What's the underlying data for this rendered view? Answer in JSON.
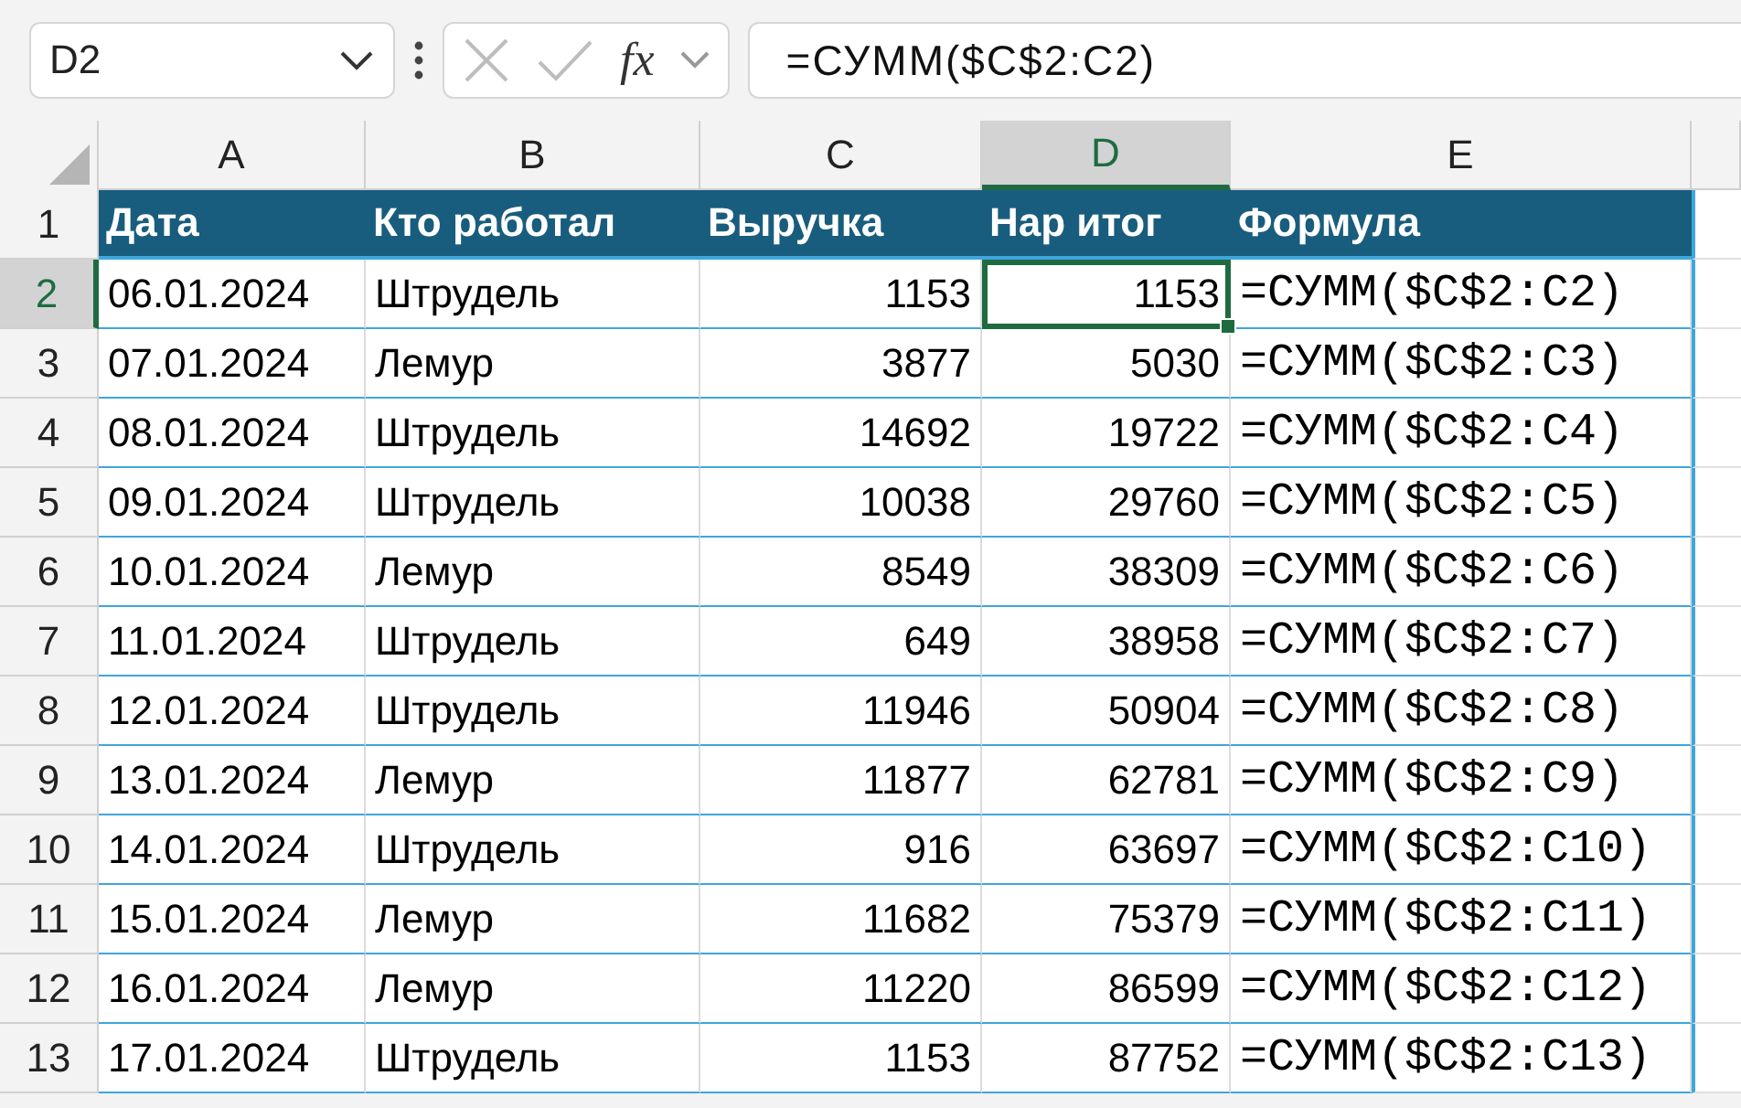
{
  "name_box": {
    "value": "D2"
  },
  "formula_bar": {
    "fx_label": "fx",
    "value": "=СУММ($C$2:C2)"
  },
  "column_headers": [
    {
      "label": "A",
      "selected": false,
      "kind": "text"
    },
    {
      "label": "B",
      "selected": false,
      "kind": "text"
    },
    {
      "label": "C",
      "selected": false,
      "kind": "number"
    },
    {
      "label": "D",
      "selected": true,
      "kind": "number"
    },
    {
      "label": "E",
      "selected": false,
      "kind": "formula"
    }
  ],
  "header_row": {
    "row_number": "1",
    "cells": [
      "Дата",
      "Кто работал",
      "Выручка",
      "Нар итог",
      "Формула"
    ]
  },
  "rows": [
    {
      "row_number": "2",
      "selected": true,
      "cells": [
        {
          "text": "06.01.2024",
          "selected": false
        },
        {
          "text": "Штрудель",
          "selected": false
        },
        {
          "text": "1153",
          "selected": false
        },
        {
          "text": "1153",
          "selected": true
        },
        {
          "text": "=СУММ($C$2:C2)",
          "selected": false
        }
      ]
    },
    {
      "row_number": "3",
      "selected": false,
      "cells": [
        {
          "text": "07.01.2024",
          "selected": false
        },
        {
          "text": "Лемур",
          "selected": false
        },
        {
          "text": "3877",
          "selected": false
        },
        {
          "text": "5030",
          "selected": false
        },
        {
          "text": "=СУММ($C$2:C3)",
          "selected": false
        }
      ]
    },
    {
      "row_number": "4",
      "selected": false,
      "cells": [
        {
          "text": "08.01.2024",
          "selected": false
        },
        {
          "text": "Штрудель",
          "selected": false
        },
        {
          "text": "14692",
          "selected": false
        },
        {
          "text": "19722",
          "selected": false
        },
        {
          "text": "=СУММ($C$2:C4)",
          "selected": false
        }
      ]
    },
    {
      "row_number": "5",
      "selected": false,
      "cells": [
        {
          "text": "09.01.2024",
          "selected": false
        },
        {
          "text": "Штрудель",
          "selected": false
        },
        {
          "text": "10038",
          "selected": false
        },
        {
          "text": "29760",
          "selected": false
        },
        {
          "text": "=СУММ($C$2:C5)",
          "selected": false
        }
      ]
    },
    {
      "row_number": "6",
      "selected": false,
      "cells": [
        {
          "text": "10.01.2024",
          "selected": false
        },
        {
          "text": "Лемур",
          "selected": false
        },
        {
          "text": "8549",
          "selected": false
        },
        {
          "text": "38309",
          "selected": false
        },
        {
          "text": "=СУММ($C$2:C6)",
          "selected": false
        }
      ]
    },
    {
      "row_number": "7",
      "selected": false,
      "cells": [
        {
          "text": "11.01.2024",
          "selected": false
        },
        {
          "text": "Штрудель",
          "selected": false
        },
        {
          "text": "649",
          "selected": false
        },
        {
          "text": "38958",
          "selected": false
        },
        {
          "text": "=СУММ($C$2:C7)",
          "selected": false
        }
      ]
    },
    {
      "row_number": "8",
      "selected": false,
      "cells": [
        {
          "text": "12.01.2024",
          "selected": false
        },
        {
          "text": "Штрудель",
          "selected": false
        },
        {
          "text": "11946",
          "selected": false
        },
        {
          "text": "50904",
          "selected": false
        },
        {
          "text": "=СУММ($C$2:C8)",
          "selected": false
        }
      ]
    },
    {
      "row_number": "9",
      "selected": false,
      "cells": [
        {
          "text": "13.01.2024",
          "selected": false
        },
        {
          "text": "Лемур",
          "selected": false
        },
        {
          "text": "11877",
          "selected": false
        },
        {
          "text": "62781",
          "selected": false
        },
        {
          "text": "=СУММ($C$2:C9)",
          "selected": false
        }
      ]
    },
    {
      "row_number": "10",
      "selected": false,
      "cells": [
        {
          "text": "14.01.2024",
          "selected": false
        },
        {
          "text": "Штрудель",
          "selected": false
        },
        {
          "text": "916",
          "selected": false
        },
        {
          "text": "63697",
          "selected": false
        },
        {
          "text": "=СУММ($C$2:C10)",
          "selected": false
        }
      ]
    },
    {
      "row_number": "11",
      "selected": false,
      "cells": [
        {
          "text": "15.01.2024",
          "selected": false
        },
        {
          "text": "Лемур",
          "selected": false
        },
        {
          "text": "11682",
          "selected": false
        },
        {
          "text": "75379",
          "selected": false
        },
        {
          "text": "=СУММ($C$2:C11)",
          "selected": false
        }
      ]
    },
    {
      "row_number": "12",
      "selected": false,
      "cells": [
        {
          "text": "16.01.2024",
          "selected": false
        },
        {
          "text": "Лемур",
          "selected": false
        },
        {
          "text": "11220",
          "selected": false
        },
        {
          "text": "86599",
          "selected": false
        },
        {
          "text": "=СУММ($C$2:C12)",
          "selected": false
        }
      ]
    },
    {
      "row_number": "13",
      "selected": false,
      "cells": [
        {
          "text": "17.01.2024",
          "selected": false
        },
        {
          "text": "Штрудель",
          "selected": false
        },
        {
          "text": "1153",
          "selected": false
        },
        {
          "text": "87752",
          "selected": false
        },
        {
          "text": "=СУММ($C$2:C13)",
          "selected": false
        }
      ]
    }
  ]
}
